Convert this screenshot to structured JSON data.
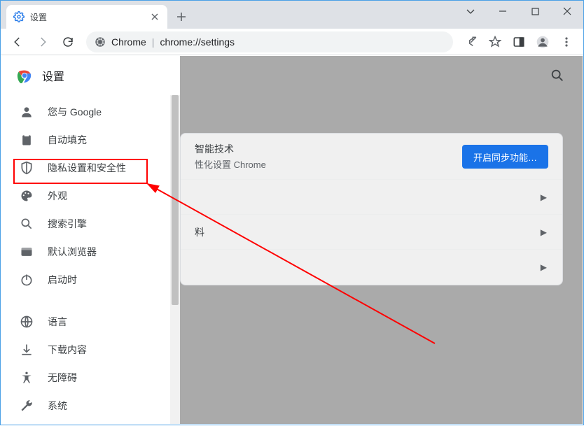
{
  "window": {
    "tab_title": "设置",
    "omnibox": {
      "product": "Chrome",
      "url": "chrome://settings"
    }
  },
  "sidebar": {
    "title": "设置",
    "items": [
      {
        "label": "您与 Google"
      },
      {
        "label": "自动填充"
      },
      {
        "label": "隐私设置和安全性"
      },
      {
        "label": "外观"
      },
      {
        "label": "搜索引擎"
      },
      {
        "label": "默认浏览器"
      },
      {
        "label": "启动时"
      }
    ],
    "items2": [
      {
        "label": "语言"
      },
      {
        "label": "下载内容"
      },
      {
        "label": "无障碍"
      },
      {
        "label": "系统"
      }
    ]
  },
  "main": {
    "card_head_line1": "智能技术",
    "card_head_line2": "性化设置 Chrome",
    "sync_button": "开启同步功能…",
    "row2": "料"
  }
}
